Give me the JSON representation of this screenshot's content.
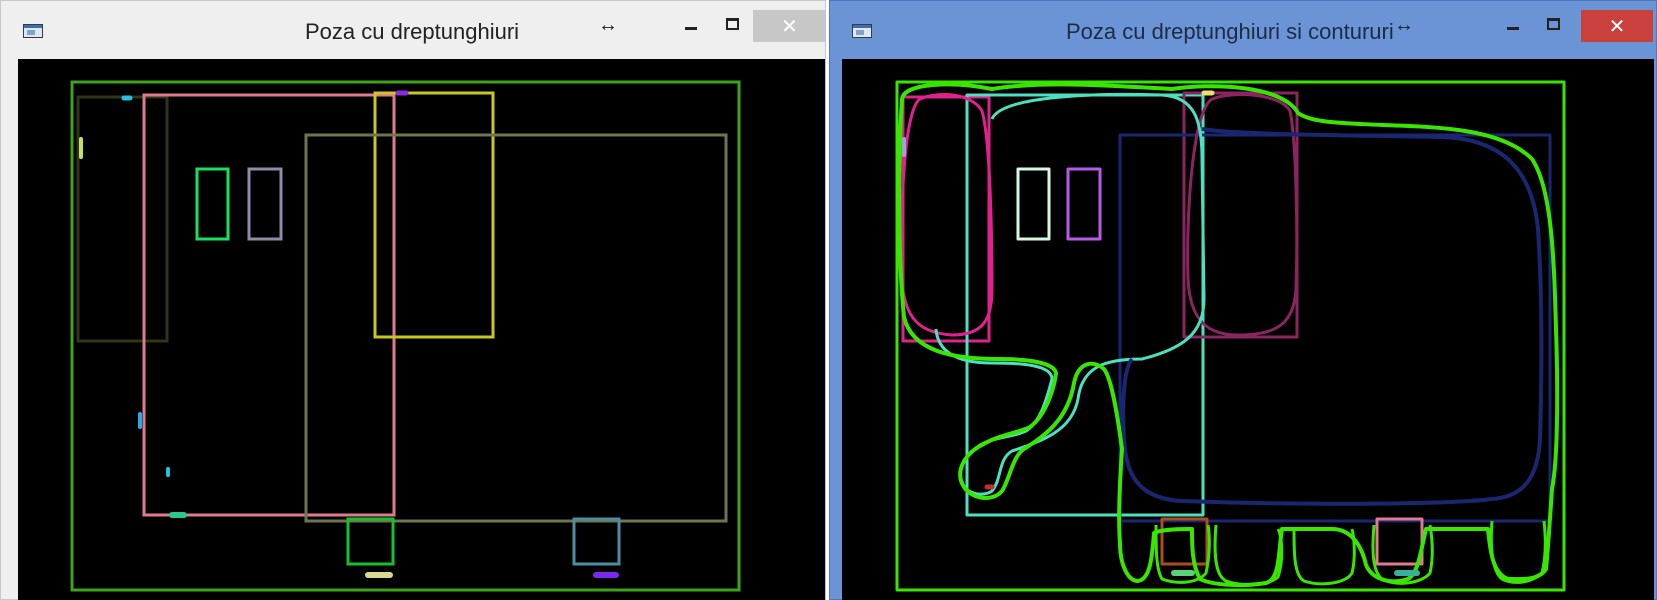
{
  "windows": {
    "left": {
      "title": "Poza cu dreptunghiuri",
      "resize_glyph": "↔",
      "close_glyph": "✕",
      "icon": "app-window-icon",
      "titlebar_color": "#efefef"
    },
    "right": {
      "title": "Poza cu dreptunghiuri si contururi",
      "resize_glyph": "↔",
      "close_glyph": "✕",
      "icon": "app-window-icon",
      "titlebar_color": "#6b94d6",
      "close_color": "#c9403d"
    }
  },
  "colors": {
    "canvas": "#000000",
    "contour_green": "#39e600",
    "rect_pink": "#e07a90",
    "rect_yellow": "#c8c81e",
    "rect_olive": "#6f7550",
    "rect_navy": "#1b2670",
    "rect_aqua": "#4de0c0"
  }
}
